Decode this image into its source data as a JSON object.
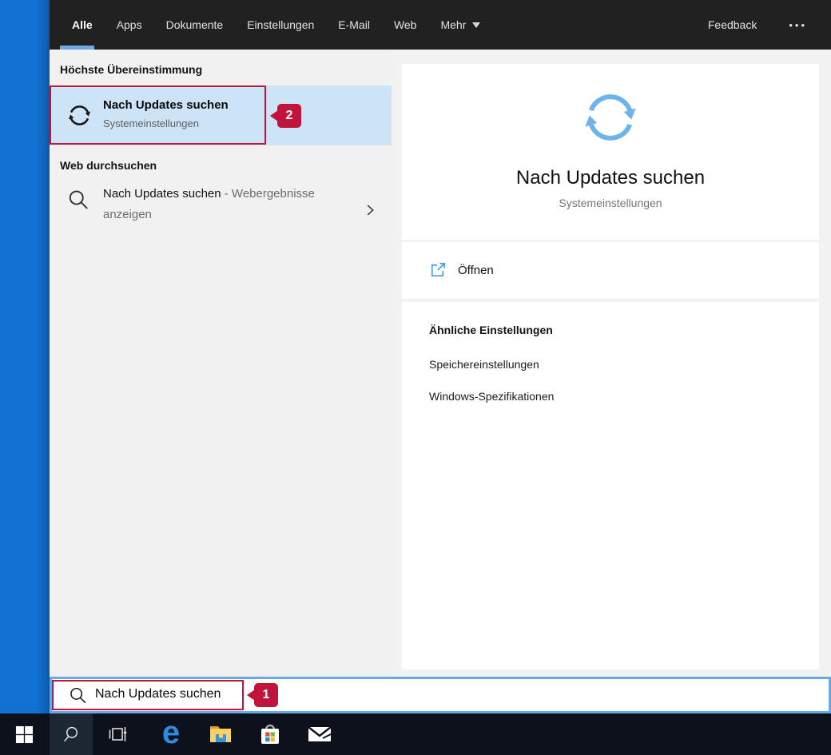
{
  "colors": {
    "desktop_blue": "#1272d2",
    "nav_bg": "#212121",
    "accent_underline": "#6da9e6",
    "highlight_row": "#cde4f7",
    "search_border": "#66a9e6",
    "annotation_red": "#c0143c",
    "taskbar_bg": "#0c111b",
    "refresh_icon_blue": "#6fb3ec"
  },
  "nav": {
    "tabs": [
      {
        "label": "Alle",
        "active": true
      },
      {
        "label": "Apps",
        "active": false
      },
      {
        "label": "Dokumente",
        "active": false
      },
      {
        "label": "Einstellungen",
        "active": false
      },
      {
        "label": "E-Mail",
        "active": false
      },
      {
        "label": "Web",
        "active": false
      }
    ],
    "more": {
      "label": "Mehr"
    },
    "feedback_label": "Feedback",
    "ellipsis": "•••"
  },
  "left_panel": {
    "best_match_header": "Höchste Übereinstimmung",
    "best_match": {
      "title": "Nach Updates suchen",
      "subtitle": "Systemeinstellungen"
    },
    "web_header": "Web durchsuchen",
    "web_result": {
      "query": "Nach Updates suchen",
      "suffix": "- Webergebnisse anzeigen"
    }
  },
  "preview": {
    "title": "Nach Updates suchen",
    "subtitle": "Systemeinstellungen",
    "open_label": "Öffnen",
    "related_header": "Ähnliche Einstellungen",
    "related_items": [
      "Speichereinstellungen",
      "Windows-Spezifikationen"
    ]
  },
  "search_bar": {
    "value": "Nach Updates suchen"
  },
  "annotations": {
    "step1_label": "1",
    "step2_label": "2"
  },
  "taskbar": {
    "edge_glyph": "e",
    "buttons": [
      {
        "name": "start",
        "icon": "windows-logo-icon"
      },
      {
        "name": "search",
        "icon": "search-icon",
        "active": true
      },
      {
        "name": "task-view",
        "icon": "task-view-icon"
      },
      {
        "name": "edge",
        "icon": "edge-icon"
      },
      {
        "name": "file-explorer",
        "icon": "folder-icon"
      },
      {
        "name": "store",
        "icon": "store-icon"
      },
      {
        "name": "mail",
        "icon": "mail-icon"
      }
    ]
  }
}
